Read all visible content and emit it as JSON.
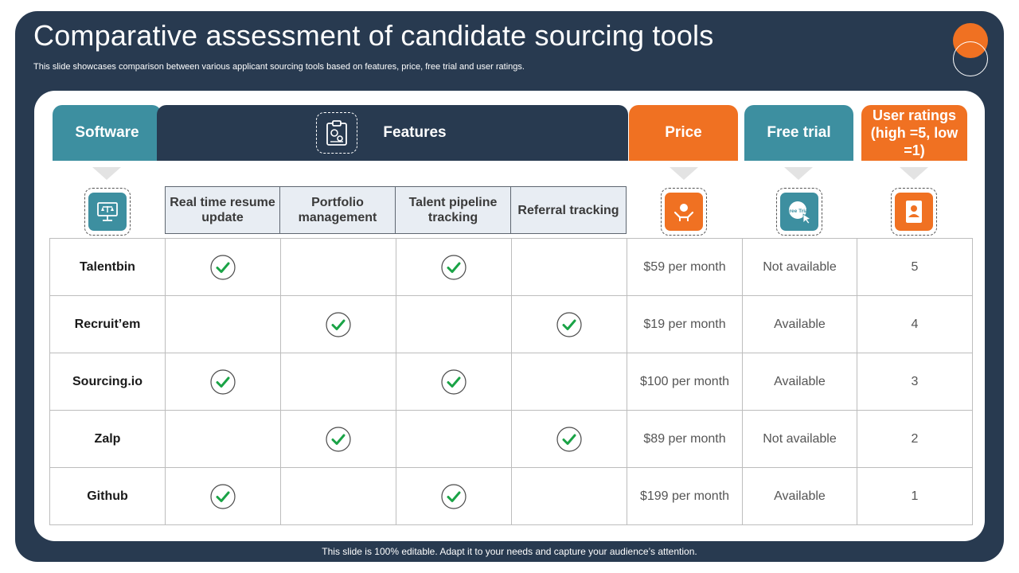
{
  "slide": {
    "title": "Comparative assessment of candidate sourcing tools",
    "subtitle": "This slide showcases comparison between various applicant sourcing tools based on features, price, free trial and user ratings.",
    "footer": "This slide is 100% editable. Adapt it to your needs and capture your audience’s attention."
  },
  "headers": {
    "software": "Software",
    "features": "Features",
    "price": "Price",
    "free_trial": "Free trial",
    "user_ratings": "User ratings (high =5, low =1)"
  },
  "icons": {
    "features": "clipboard-gears-icon",
    "software": "scales-monitor-icon",
    "price": "hand-coins-icon",
    "free_trial": "free-trial-click-icon",
    "user_ratings": "profile-card-icon",
    "check": "checkmark-circle-icon",
    "free_trial_icon_text": "Free Trial"
  },
  "feature_columns": [
    "Real time resume update",
    "Portfolio management",
    "Talent pipeline tracking",
    "Referral tracking"
  ],
  "rows": [
    {
      "software": "Talentbin",
      "features": [
        true,
        false,
        true,
        false
      ],
      "price": "$59 per month",
      "free_trial": "Not available",
      "rating": "5"
    },
    {
      "software": "Recruit’em",
      "features": [
        false,
        true,
        false,
        true
      ],
      "price": "$19 per month",
      "free_trial": "Available",
      "rating": "4"
    },
    {
      "software": "Sourcing.io",
      "features": [
        true,
        false,
        true,
        false
      ],
      "price": "$100 per month",
      "free_trial": "Available",
      "rating": "3"
    },
    {
      "software": "Zalp",
      "features": [
        false,
        true,
        false,
        true
      ],
      "price": "$89 per month",
      "free_trial": "Not available",
      "rating": "2"
    },
    {
      "software": "Github",
      "features": [
        true,
        false,
        true,
        false
      ],
      "price": "$199 per month",
      "free_trial": "Available",
      "rating": "1"
    }
  ],
  "colors": {
    "navy": "#283a50",
    "teal": "#3d8fa0",
    "orange": "#f07122",
    "check_green": "#1aa346"
  }
}
